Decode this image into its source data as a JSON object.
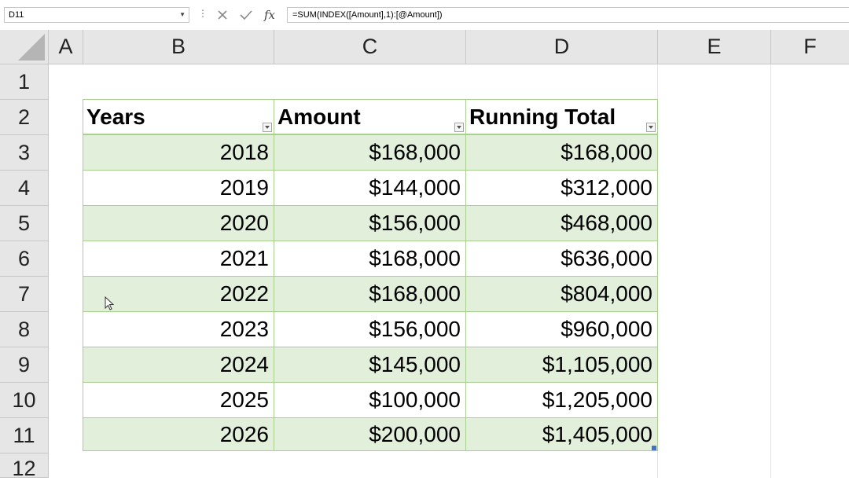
{
  "formula_bar": {
    "name_box": "D11",
    "formula": "=SUM(INDEX([Amount],1):[@Amount])"
  },
  "columns": [
    "A",
    "B",
    "C",
    "D",
    "E",
    "F"
  ],
  "rows": [
    "1",
    "2",
    "3",
    "4",
    "5",
    "6",
    "7",
    "8",
    "9",
    "10",
    "11",
    "12"
  ],
  "table": {
    "headers": [
      "Years",
      "Amount",
      "Running Total"
    ],
    "rows": [
      [
        "2018",
        "$168,000",
        "$168,000"
      ],
      [
        "2019",
        "$144,000",
        "$312,000"
      ],
      [
        "2020",
        "$156,000",
        "$468,000"
      ],
      [
        "2021",
        "$168,000",
        "$636,000"
      ],
      [
        "2022",
        "$168,000",
        "$804,000"
      ],
      [
        "2023",
        "$156,000",
        "$960,000"
      ],
      [
        "2024",
        "$145,000",
        "$1,105,000"
      ],
      [
        "2025",
        "$100,000",
        "$1,205,000"
      ],
      [
        "2026",
        "$200,000",
        "$1,405,000"
      ]
    ]
  },
  "colors": {
    "table_border": "#a9d08e",
    "band": "#e2efda",
    "header_bg": "#e6e6e6"
  },
  "icons": {
    "cancel": "close-icon",
    "enter": "check-icon",
    "insert_function": "fx-icon"
  }
}
